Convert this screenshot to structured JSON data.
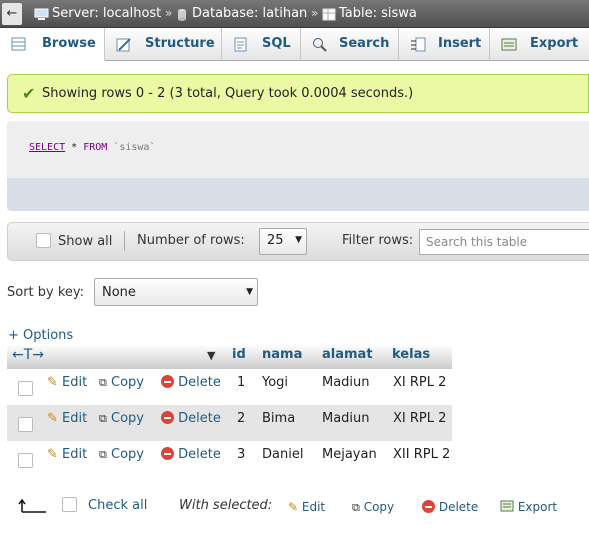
{
  "breadcrumb": {
    "server": "Server: localhost",
    "database": "Database: latihan",
    "table": "Table: siswa",
    "separator": "»",
    "back_icon": "left-arrow-icon"
  },
  "tabs": [
    {
      "label": "Browse",
      "icon": "browse-icon"
    },
    {
      "label": "Structure",
      "icon": "structure-icon"
    },
    {
      "label": "SQL",
      "icon": "sql-icon"
    },
    {
      "label": "Search",
      "icon": "search-icon"
    },
    {
      "label": "Insert",
      "icon": "insert-icon"
    },
    {
      "label": "Export",
      "icon": "export-icon"
    }
  ],
  "success_message": "Showing rows 0 - 2 (3 total, Query took 0.0004 seconds.)",
  "sql": {
    "select": "SELECT",
    "star": " * ",
    "from": "FROM",
    "table": " `siswa`"
  },
  "navigation": {
    "show_all": "Show all",
    "number_of_rows_label": "Number of rows:",
    "number_of_rows_value": "25",
    "filter_rows_label": "Filter rows:",
    "filter_placeholder": "Search this table"
  },
  "sort": {
    "label": "Sort by key:",
    "value": "None"
  },
  "options_link": "+ Options",
  "table": {
    "arrows": "←T→",
    "columns": [
      "id",
      "nama",
      "alamat",
      "kelas"
    ],
    "action_labels": {
      "edit": "Edit",
      "copy": "Copy",
      "delete": "Delete"
    },
    "rows": [
      [
        "1",
        "Yogi",
        "Madiun",
        "XI RPL 2"
      ],
      [
        "2",
        "Bima",
        "Madiun",
        "XI RPL 2"
      ],
      [
        "3",
        "Daniel",
        "Mejayan",
        "XII RPL 2"
      ]
    ]
  },
  "footer": {
    "check_all": "Check all",
    "with_selected": "With selected:",
    "edit": "Edit",
    "copy": "Copy",
    "delete": "Delete",
    "export": "Export"
  },
  "colors": {
    "link": "#235a81",
    "success_bg": "#ebf8a4",
    "delete": "#d9443b"
  }
}
